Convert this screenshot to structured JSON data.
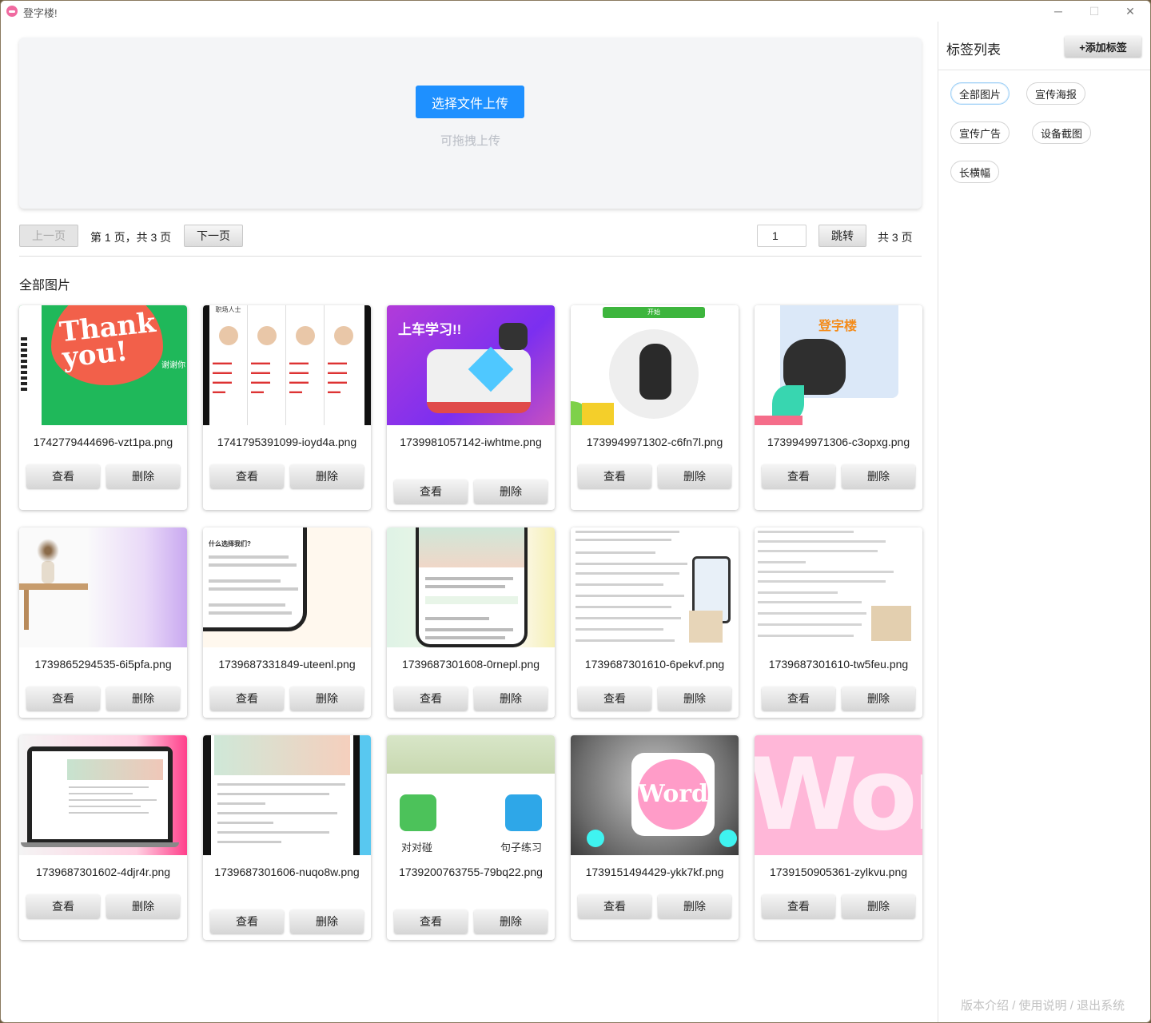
{
  "window": {
    "title": "登字楼!",
    "controls": {
      "minimize": "─",
      "maximize": "☐",
      "close": "✕"
    }
  },
  "upload": {
    "button_label": "选择文件上传",
    "drag_hint": "可拖拽上传"
  },
  "pager": {
    "prev_label": "上一页",
    "page_info": "第 1 页，共 3 页",
    "next_label": "下一页",
    "page_input_value": "1",
    "jump_label": "跳转",
    "total_info": "共 3 页"
  },
  "section_title": "全部图片",
  "card_buttons": {
    "view": "查看",
    "delete": "删除"
  },
  "images": [
    {
      "filename": "1742779444696-vzt1pa.png",
      "thumb_text": "谢谢你",
      "thumb_title": "Thank you!"
    },
    {
      "filename": "1741795391099-ioyd4a.png",
      "thumb_text": "职场人士"
    },
    {
      "filename": "1739981057142-iwhtme.png",
      "thumb_text": "上车学习!!"
    },
    {
      "filename": "1739949971302-c6fn7l.png",
      "thumb_text": "开始"
    },
    {
      "filename": "1739949971306-c3opxg.png",
      "thumb_text": "登字楼"
    },
    {
      "filename": "1739865294535-6i5pfa.png"
    },
    {
      "filename": "1739687331849-uteenl.png",
      "thumb_text": "什么选择我们?"
    },
    {
      "filename": "1739687301608-0rnepl.png"
    },
    {
      "filename": "1739687301610-6pekvf.png"
    },
    {
      "filename": "1739687301610-tw5feu.png"
    },
    {
      "filename": "1739687301602-4djr4r.png"
    },
    {
      "filename": "1739687301606-nuqo8w.png"
    },
    {
      "filename": "1739200763755-79bq22.png",
      "thumb_labels": [
        "对对碰",
        "句子练习"
      ]
    },
    {
      "filename": "1739151494429-ykk7kf.png",
      "thumb_text": "Word"
    },
    {
      "filename": "1739150905361-zylkvu.png",
      "thumb_text": "Wor"
    }
  ],
  "sidebar": {
    "title": "标签列表",
    "add_label": "+添加标签",
    "tags": [
      "全部图片",
      "宣传海报",
      "宣传广告",
      "设备截图",
      "长横幅"
    ],
    "active_tag": "全部图片",
    "footer": {
      "about": "版本介绍",
      "help": "使用说明",
      "logout": "退出系统",
      "separator": "/"
    }
  },
  "colors": {
    "primary": "#1e90ff",
    "logo": "#f06aa0"
  }
}
